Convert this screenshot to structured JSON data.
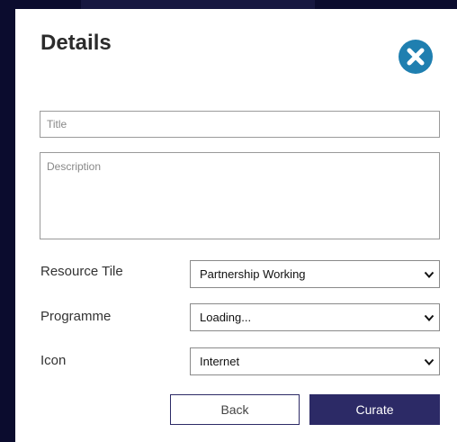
{
  "modal": {
    "title": "Details",
    "close_icon": "close-circle-icon"
  },
  "form": {
    "title_placeholder": "Title",
    "title_value": "",
    "description_placeholder": "Description",
    "description_value": ""
  },
  "selects": {
    "resource_tile": {
      "label": "Resource Tile",
      "value": "Partnership Working"
    },
    "programme": {
      "label": "Programme",
      "value": "Loading..."
    },
    "icon": {
      "label": "Icon",
      "value": "Internet"
    }
  },
  "buttons": {
    "back_label": "Back",
    "curate_label": "Curate"
  },
  "colors": {
    "backdrop": "#0b0c2e",
    "accent": "#2c2a66",
    "close_button": "#1f7fb0"
  }
}
